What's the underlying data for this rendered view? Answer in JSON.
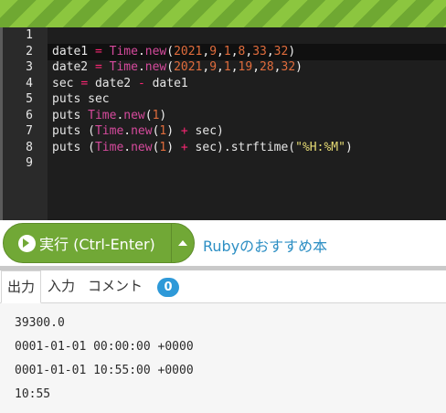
{
  "editor": {
    "line_numbers": [
      "1",
      "2",
      "3",
      "4",
      "5",
      "6",
      "7",
      "8",
      "9"
    ],
    "current_line": "1",
    "lines": [
      [],
      [
        {
          "t": "date1 ",
          "c": "kw"
        },
        {
          "t": "=",
          "c": "op"
        },
        {
          "t": " ",
          "c": "kw"
        },
        {
          "t": "Time",
          "c": "cls"
        },
        {
          "t": ".",
          "c": "punc"
        },
        {
          "t": "new",
          "c": "cls"
        },
        {
          "t": "(",
          "c": "punc"
        },
        {
          "t": "2021",
          "c": "num"
        },
        {
          "t": ",",
          "c": "punc"
        },
        {
          "t": "9",
          "c": "num"
        },
        {
          "t": ",",
          "c": "punc"
        },
        {
          "t": "1",
          "c": "num"
        },
        {
          "t": ",",
          "c": "punc"
        },
        {
          "t": "8",
          "c": "num"
        },
        {
          "t": ",",
          "c": "punc"
        },
        {
          "t": "33",
          "c": "num"
        },
        {
          "t": ",",
          "c": "punc"
        },
        {
          "t": "32",
          "c": "num"
        },
        {
          "t": ")",
          "c": "punc"
        }
      ],
      [
        {
          "t": "date2 ",
          "c": "kw"
        },
        {
          "t": "=",
          "c": "op"
        },
        {
          "t": " ",
          "c": "kw"
        },
        {
          "t": "Time",
          "c": "cls"
        },
        {
          "t": ".",
          "c": "punc"
        },
        {
          "t": "new",
          "c": "cls"
        },
        {
          "t": "(",
          "c": "punc"
        },
        {
          "t": "2021",
          "c": "num"
        },
        {
          "t": ",",
          "c": "punc"
        },
        {
          "t": "9",
          "c": "num"
        },
        {
          "t": ",",
          "c": "punc"
        },
        {
          "t": "1",
          "c": "num"
        },
        {
          "t": ",",
          "c": "punc"
        },
        {
          "t": "19",
          "c": "num"
        },
        {
          "t": ",",
          "c": "punc"
        },
        {
          "t": "28",
          "c": "num"
        },
        {
          "t": ",",
          "c": "punc"
        },
        {
          "t": "32",
          "c": "num"
        },
        {
          "t": ")",
          "c": "punc"
        }
      ],
      [
        {
          "t": "sec ",
          "c": "kw"
        },
        {
          "t": "=",
          "c": "op"
        },
        {
          "t": " date2 ",
          "c": "kw"
        },
        {
          "t": "-",
          "c": "op"
        },
        {
          "t": " date1",
          "c": "kw"
        }
      ],
      [
        {
          "t": "puts sec",
          "c": "kw"
        }
      ],
      [
        {
          "t": "puts ",
          "c": "kw"
        },
        {
          "t": "Time",
          "c": "cls"
        },
        {
          "t": ".",
          "c": "punc"
        },
        {
          "t": "new",
          "c": "cls"
        },
        {
          "t": "(",
          "c": "punc"
        },
        {
          "t": "1",
          "c": "num"
        },
        {
          "t": ")",
          "c": "punc"
        }
      ],
      [
        {
          "t": "puts (",
          "c": "kw"
        },
        {
          "t": "Time",
          "c": "cls"
        },
        {
          "t": ".",
          "c": "punc"
        },
        {
          "t": "new",
          "c": "cls"
        },
        {
          "t": "(",
          "c": "punc"
        },
        {
          "t": "1",
          "c": "num"
        },
        {
          "t": ") ",
          "c": "punc"
        },
        {
          "t": "+",
          "c": "op"
        },
        {
          "t": " sec)",
          "c": "kw"
        }
      ],
      [
        {
          "t": "puts (",
          "c": "kw"
        },
        {
          "t": "Time",
          "c": "cls"
        },
        {
          "t": ".",
          "c": "punc"
        },
        {
          "t": "new",
          "c": "cls"
        },
        {
          "t": "(",
          "c": "punc"
        },
        {
          "t": "1",
          "c": "num"
        },
        {
          "t": ") ",
          "c": "punc"
        },
        {
          "t": "+",
          "c": "op"
        },
        {
          "t": " sec).strftime(",
          "c": "kw"
        },
        {
          "t": "\"%H:%M\"",
          "c": "str"
        },
        {
          "t": ")",
          "c": "punc"
        }
      ],
      []
    ]
  },
  "toolbar": {
    "run_label": "実行 (Ctrl-Enter)",
    "book_link": "Rubyのおすすめ本",
    "run_color": "#71a836"
  },
  "tabs": {
    "output": "出力",
    "input": "入力",
    "comment": "コメント",
    "comment_count": "0"
  },
  "output": {
    "lines": [
      "39300.0",
      "0001-01-01 00:00:00 +0000",
      "0001-01-01 10:55:00 +0000",
      "10:55"
    ]
  }
}
